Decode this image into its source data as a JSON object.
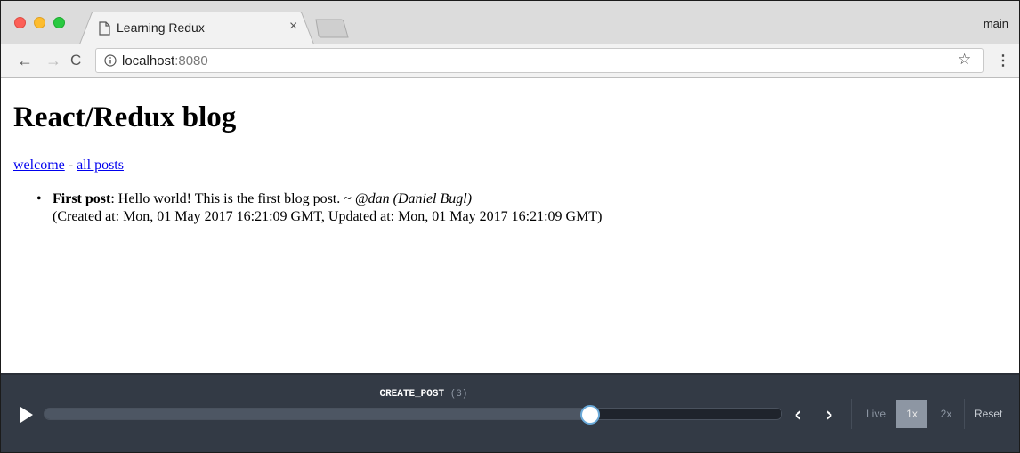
{
  "browser": {
    "tab_title": "Learning Redux",
    "tab_close": "×",
    "profile_name": "main",
    "url_host": "localhost",
    "url_port": ":8080",
    "back_icon": "←",
    "forward_icon": "→",
    "reload_icon": "C",
    "star_icon": "☆",
    "menu_icon": "⋮"
  },
  "page": {
    "title": "React/Redux blog",
    "nav": {
      "welcome": "welcome",
      "separator": " - ",
      "all_posts": "all posts"
    },
    "posts": [
      {
        "bullet": "•",
        "title": "First post",
        "separator": ": ",
        "body": "Hello world! This is the first blog post. ~ ",
        "author": "@dan (Daniel Bugl)",
        "meta": "(Created at: Mon, 01 May 2017 16:21:09 GMT, Updated at: Mon, 01 May 2017 16:21:09 GMT)"
      }
    ]
  },
  "devtools": {
    "action_name": "CREATE_POST",
    "action_count": "(3)",
    "slider_position": 0.74,
    "prev_icon": "‹",
    "next_icon": "›",
    "speed_live": "Live",
    "speed_1x": "1x",
    "speed_2x": "2x",
    "selected_speed": "1x",
    "reset_label": "Reset"
  },
  "colors": {
    "dock_bg": "#333a45",
    "slider_thumb_border": "#6aa9d8",
    "link": "#0000ee"
  }
}
